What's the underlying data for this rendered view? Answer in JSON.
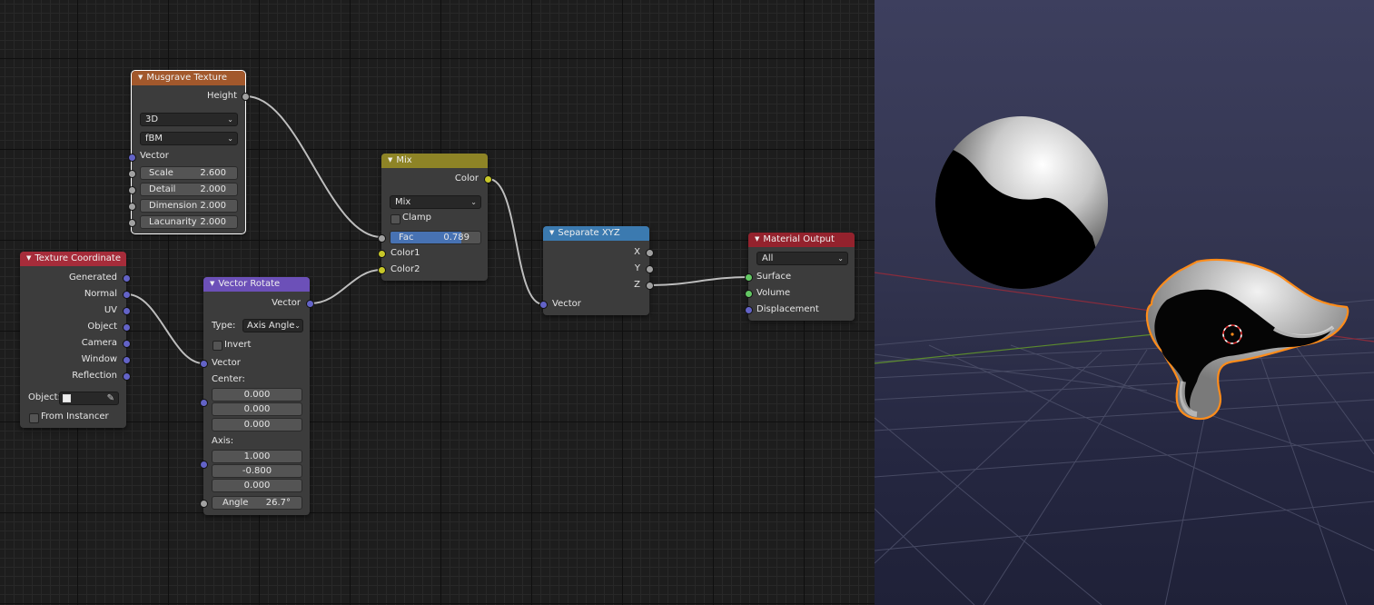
{
  "node_editor": {
    "nodes": {
      "musgrave": {
        "title": "Musgrave Texture",
        "output_height": "Height",
        "dimensions_select": "3D",
        "type_select": "fBM",
        "input_vector": "Vector",
        "scale": {
          "label": "Scale",
          "value": "2.600"
        },
        "detail": {
          "label": "Detail",
          "value": "2.000"
        },
        "dimension": {
          "label": "Dimension",
          "value": "2.000"
        },
        "lacunarity": {
          "label": "Lacunarity",
          "value": "2.000"
        }
      },
      "texture_coordinate": {
        "title": "Texture Coordinate",
        "outputs": [
          "Generated",
          "Normal",
          "UV",
          "Object",
          "Camera",
          "Window",
          "Reflection"
        ],
        "object_label": "Object:",
        "from_instancer": "From Instancer"
      },
      "vector_rotate": {
        "title": "Vector Rotate",
        "output_vector": "Vector",
        "type_label": "Type:",
        "type_value": "Axis Angle",
        "invert": "Invert",
        "input_vector": "Vector",
        "center_label": "Center:",
        "center": [
          "0.000",
          "0.000",
          "0.000"
        ],
        "axis_label": "Axis:",
        "axis": [
          "1.000",
          "-0.800",
          "0.000"
        ],
        "angle": {
          "label": "Angle",
          "value": "26.7°"
        }
      },
      "mix": {
        "title": "Mix",
        "output_color": "Color",
        "blend_select": "Mix",
        "clamp": "Clamp",
        "fac": {
          "label": "Fac",
          "value": "0.789",
          "fraction": 0.789
        },
        "color1": "Color1",
        "color2": "Color2"
      },
      "separate_xyz": {
        "title": "Separate XYZ",
        "outputs": [
          "X",
          "Y",
          "Z"
        ],
        "input_vector": "Vector"
      },
      "material_output": {
        "title": "Material Output",
        "target_select": "All",
        "inputs": [
          "Surface",
          "Volume",
          "Displacement"
        ]
      }
    }
  },
  "colors": {
    "header_texture": "#a2582c",
    "header_input": "#a62c3a",
    "header_vector": "#6c50b8",
    "header_color": "#8e8426",
    "header_converter": "#3b7ab0",
    "header_output": "#94222d",
    "socket_vector": "#6363c7",
    "socket_color": "#c7c729",
    "socket_float": "#a1a1a1",
    "socket_shader": "#63c763",
    "selection_outline": "#ff8c1a",
    "fac_fill": "#4772b3"
  },
  "viewport": {
    "objects": [
      "sphere",
      "suzanne-monkey"
    ],
    "icons": [
      "3d-cursor-icon"
    ]
  }
}
